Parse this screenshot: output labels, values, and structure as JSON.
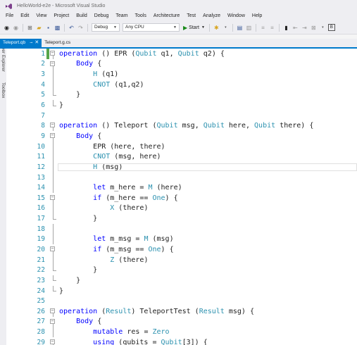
{
  "window": {
    "title": "HelloWorld-e2e - Microsoft Visual Studio"
  },
  "menu": [
    "File",
    "Edit",
    "View",
    "Project",
    "Build",
    "Debug",
    "Team",
    "Tools",
    "Architecture",
    "Test",
    "Analyze",
    "Window",
    "Help"
  ],
  "toolbar": {
    "config_value": "Debug",
    "platform_value": "Any CPU",
    "start_label": "Start"
  },
  "tabs": [
    {
      "label": "Teleport.qb",
      "active": true
    },
    {
      "label": "Teleport.g.cs",
      "active": false
    }
  ],
  "side_panels": [
    "Server Explorer",
    "Toolbox"
  ],
  "colors": {
    "accent": "#007acc",
    "keyword": "#0000ff",
    "type": "#2b91af",
    "line_number": "#2b91af",
    "saved_change": "#57a64a"
  },
  "code": {
    "current_line": 12,
    "lines": [
      {
        "n": "1",
        "text": "operation () EPR (Qubit q1, Qubit q2) {"
      },
      {
        "n": "2",
        "text": "    Body {"
      },
      {
        "n": "3",
        "text": "        H (q1)"
      },
      {
        "n": "4",
        "text": "        CNOT (q1,q2)"
      },
      {
        "n": "5",
        "text": "    }"
      },
      {
        "n": "6",
        "text": "}"
      },
      {
        "n": "7",
        "text": ""
      },
      {
        "n": "8",
        "text": "operation () Teleport (Qubit msg, Qubit here, Qubit there) {"
      },
      {
        "n": "9",
        "text": "    Body {"
      },
      {
        "n": "10",
        "text": "        EPR (here, there)"
      },
      {
        "n": "11",
        "text": "        CNOT (msg, here)"
      },
      {
        "n": "12",
        "text": "        H (msg)"
      },
      {
        "n": "13",
        "text": ""
      },
      {
        "n": "14",
        "text": "        let m_here = M (here)"
      },
      {
        "n": "15",
        "text": "        if (m_here == One) {"
      },
      {
        "n": "16",
        "text": "            X (there)"
      },
      {
        "n": "17",
        "text": "        }"
      },
      {
        "n": "18",
        "text": ""
      },
      {
        "n": "19",
        "text": "        let m_msg = M (msg)"
      },
      {
        "n": "20",
        "text": "        if (m_msg == One) {"
      },
      {
        "n": "21",
        "text": "            Z (there)"
      },
      {
        "n": "22",
        "text": "        }"
      },
      {
        "n": "23",
        "text": "    }"
      },
      {
        "n": "24",
        "text": "}"
      },
      {
        "n": "25",
        "text": ""
      },
      {
        "n": "26",
        "text": "operation (Result) TeleportTest (Result msg) {"
      },
      {
        "n": "27",
        "text": "    Body {"
      },
      {
        "n": "28",
        "text": "        mutable res = Zero"
      },
      {
        "n": "29",
        "text": "        using (qubits = Qubit[3]) {"
      }
    ]
  }
}
